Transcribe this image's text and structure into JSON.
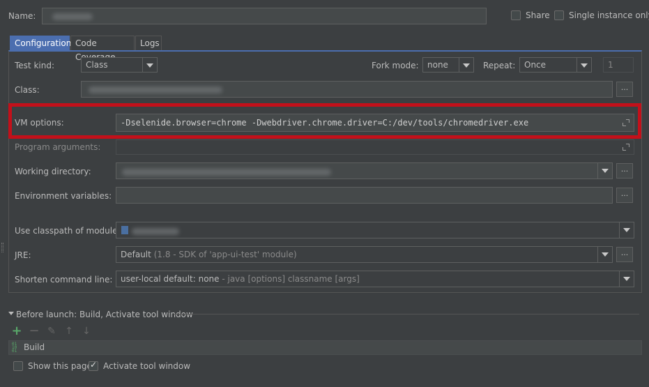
{
  "header": {
    "name_label": "Name:",
    "share_label": "Share",
    "single_instance_label": "Single instance only"
  },
  "tabs": [
    {
      "label": "Configuration"
    },
    {
      "label": "Code Coverage"
    },
    {
      "label": "Logs"
    }
  ],
  "config": {
    "test_kind_label": "Test kind:",
    "test_kind_value": "Class",
    "fork_mode_label": "Fork mode:",
    "fork_mode_value": "none",
    "repeat_label": "Repeat:",
    "repeat_value": "Once",
    "repeat_count": "1",
    "class_label": "Class:",
    "vm_options_label": "VM options:",
    "vm_options_value": "-Dselenide.browser=chrome -Dwebdriver.chrome.driver=C:/dev/tools/chromedriver.exe",
    "program_args_label": "Program arguments:",
    "working_dir_label": "Working directory:",
    "env_vars_label": "Environment variables:",
    "classpath_label": "Use classpath of module:",
    "jre_label": "JRE:",
    "jre_value": "Default",
    "jre_detail": "(1.8 - SDK of 'app-ui-test' module)",
    "shorten_label": "Shorten command line:",
    "shorten_value": "user-local default: none",
    "shorten_detail": " - java [options] classname [args]",
    "ellipsis": "..."
  },
  "before_launch": {
    "title": "Before launch: Build, Activate tool window",
    "toolbar_icons": [
      "plus-icon",
      "minus-icon",
      "pencil-icon",
      "arrow-up-icon",
      "arrow-down-icon"
    ],
    "items": [
      {
        "label": "Build",
        "icon": "build-icon"
      }
    ],
    "show_page_label": "Show this page",
    "activate_label": "Activate tool window"
  },
  "colors": {
    "accent": "#4b6eaf",
    "highlight_box": "#c3101a",
    "add_green": "#59a869"
  }
}
